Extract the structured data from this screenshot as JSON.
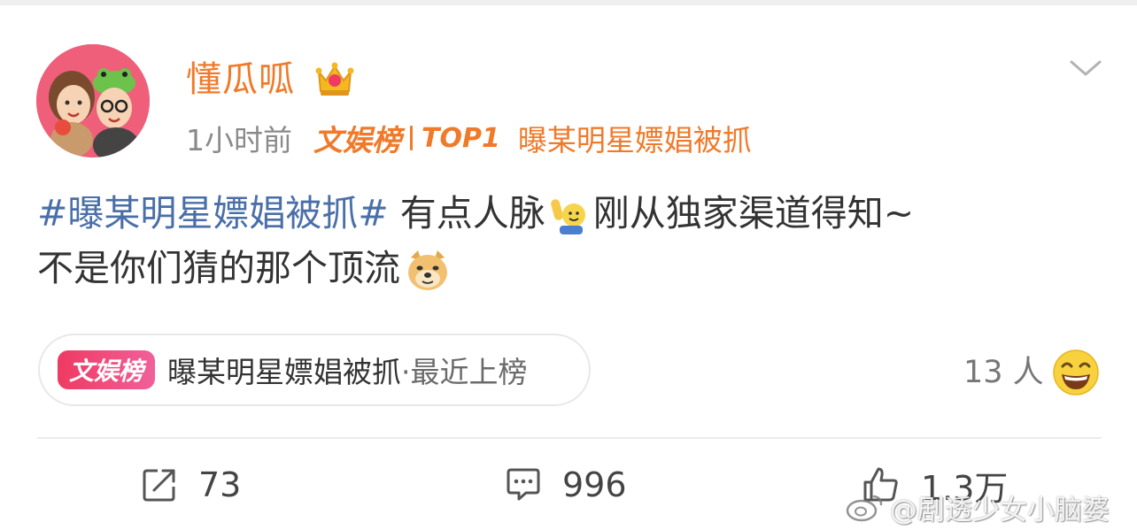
{
  "author": {
    "name": "懂瓜呱",
    "badge_icon": "crown-icon",
    "time": "1小时前",
    "rank_brand": "文娱榜",
    "rank_position": "TOP1",
    "rank_topic": "曝某明星嫖娼被抓"
  },
  "post": {
    "hashtag": "#曝某明星嫖娼被抓#",
    "text_part1": " 有点人脉",
    "emoji1": "hand-raise-emoji",
    "text_part2": "刚从独家渠道得知~",
    "text_part3": "不是你们猜的那个顶流",
    "emoji2": "doge-emoji"
  },
  "topic_card": {
    "badge": "文娱榜",
    "topic": "曝某明星嫖娼被抓",
    "status": "·最近上榜"
  },
  "participants": {
    "count_label": "13 人",
    "emoji": "laugh-emoji"
  },
  "actions": {
    "repost_count": "73",
    "comment_count": "996",
    "like_count": "1.3万"
  },
  "watermark": {
    "text": "@剧透少女小脑婆"
  },
  "colors": {
    "username": "#f07a2a",
    "hashtag": "#4a6fa8",
    "badge_gradient_start": "#ef3a62",
    "badge_gradient_end": "#f0609a",
    "avatar_bg": "#ef5f7a"
  }
}
